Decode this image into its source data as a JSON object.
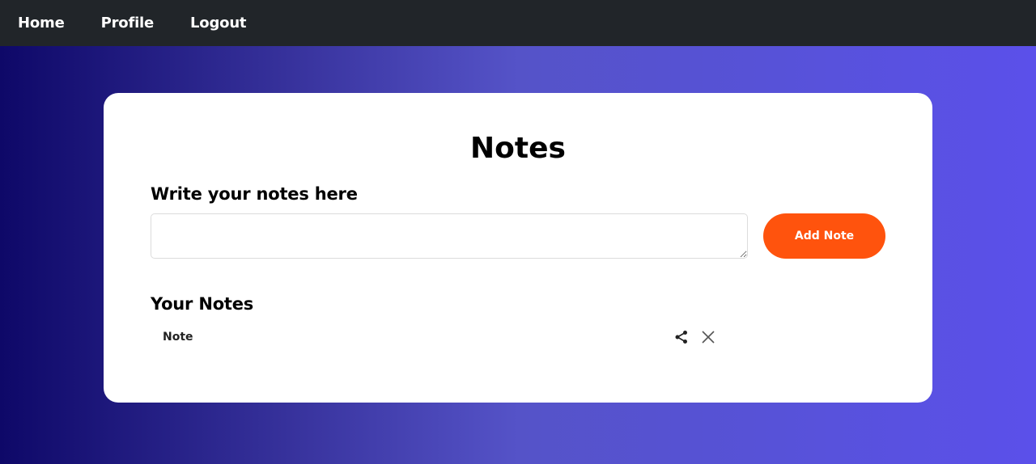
{
  "nav": {
    "items": [
      {
        "label": "Home"
      },
      {
        "label": "Profile"
      },
      {
        "label": "Logout"
      }
    ]
  },
  "card": {
    "title": "Notes",
    "write_label": "Write your notes here",
    "input_value": "",
    "add_button_label": "Add Note",
    "notes_label": "Your Notes",
    "notes": [
      {
        "text": "Note"
      }
    ]
  },
  "icons": {
    "share": "share-icon",
    "close": "close-icon"
  },
  "colors": {
    "navbar_bg": "#212529",
    "accent": "#ff530d",
    "gradient_start": "#0e0868",
    "gradient_end": "#5b50ea"
  }
}
